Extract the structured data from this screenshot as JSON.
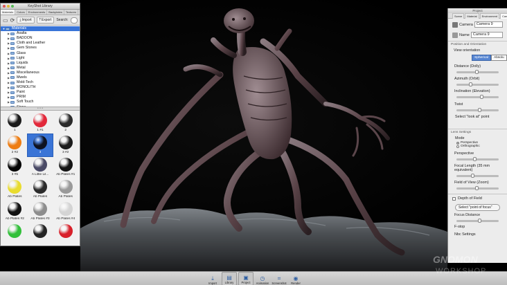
{
  "library": {
    "title": "KeyShot Library",
    "tabs": [
      "Materials",
      "Colors",
      "Environments",
      "Backplates",
      "Textures",
      "Renderings"
    ],
    "toolbar": {
      "import_label": "Import",
      "export_label": "Export",
      "search_label": "Search:"
    },
    "tree": [
      {
        "label": "Materials",
        "root": true,
        "selected": true
      },
      {
        "label": "Axalta"
      },
      {
        "label": "BADOON"
      },
      {
        "label": "Cloth and Leather"
      },
      {
        "label": "Gem Stones"
      },
      {
        "label": "Glass"
      },
      {
        "label": "Light"
      },
      {
        "label": "Liquids"
      },
      {
        "label": "Metal"
      },
      {
        "label": "Miscellaneous"
      },
      {
        "label": "Mwels"
      },
      {
        "label": "Mold-Tech"
      },
      {
        "label": "MONOLITH"
      },
      {
        "label": "Paint"
      },
      {
        "label": "PRIM"
      },
      {
        "label": "Soft Touch"
      },
      {
        "label": "Stone"
      }
    ],
    "materials": [
      {
        "label": "1",
        "color": "#1a1a1a"
      },
      {
        "label": "1 #1",
        "color": "#e2283a"
      },
      {
        "label": "2",
        "color": "#2a2a2a"
      },
      {
        "label": "2 #2",
        "color": "#ee7d12"
      },
      {
        "label": "3",
        "color": "#0e1220",
        "selected": true
      },
      {
        "label": "3 #2",
        "color": "#1c1c1c"
      },
      {
        "label": "3 #5",
        "color": "#050505"
      },
      {
        "label": "A Little Lil...",
        "color": "#4a4a66"
      },
      {
        "label": "Ab Plates #1",
        "color": "#141414"
      },
      {
        "label": "Ab Plates",
        "color": "#e9dc2e"
      },
      {
        "label": "Ab Plates",
        "color": "#2b2b2b"
      },
      {
        "label": "Ab Plates",
        "color": "#9a9a9a"
      },
      {
        "label": "Ab Plates #2",
        "color": "#111111"
      },
      {
        "label": "Ab Plates #3",
        "color": "#8d8d8d"
      },
      {
        "label": "Ab Plates #4",
        "color": "#d4d4d4"
      },
      {
        "label": "",
        "color": "#32c03a"
      },
      {
        "label": "",
        "color": "#242424"
      },
      {
        "label": "",
        "color": "#d8202a"
      }
    ]
  },
  "project": {
    "title": "Project",
    "tabs": [
      "Scene",
      "Material",
      "Environment",
      "Camera"
    ],
    "camera_label": "Camera",
    "camera_value": "Camera 9",
    "name_label": "Name",
    "name_value": "Camera 9",
    "position_section": "Position and Orientation",
    "view_orientation": "View orientation",
    "spherical": "Spherical",
    "absolute": "Absolu",
    "distance": "Distance (Dolly)",
    "azimuth": "Azimuth (Orbit)",
    "inclination": "Inclination (Elevation)",
    "twist": "Twist",
    "look_at": "Select \"look at\" point",
    "lens_section": "Lens Settings",
    "mode": "Mode",
    "perspective_opt": "Perspective",
    "orthographic_opt": "Orthographic",
    "perspective": "Perspective",
    "focal_length": "Focal Length (35 mm equivalent)",
    "field_of_view": "Field of View (Zoom)",
    "depth_of_field": "Depth of Field",
    "focus_point": "Select \"point of focus\"",
    "focus_distance": "Focus Distance",
    "fstop": "F-stop",
    "more_settings": "Nbc Settings"
  },
  "dock": [
    {
      "label": "Import",
      "icon": "import-icon",
      "glyph": "⤓"
    },
    {
      "label": "Library",
      "icon": "library-icon",
      "glyph": "▤",
      "active": true
    },
    {
      "label": "Project",
      "icon": "project-icon",
      "glyph": "▣",
      "active": true
    },
    {
      "label": "Animation",
      "icon": "animation-icon",
      "glyph": "◷"
    },
    {
      "label": "Screenshot",
      "icon": "screenshot-icon",
      "glyph": "⌗"
    },
    {
      "label": "Render",
      "icon": "render-icon",
      "glyph": "◉"
    }
  ],
  "colors": {
    "accent": "#3874d8",
    "background": "#000000"
  }
}
